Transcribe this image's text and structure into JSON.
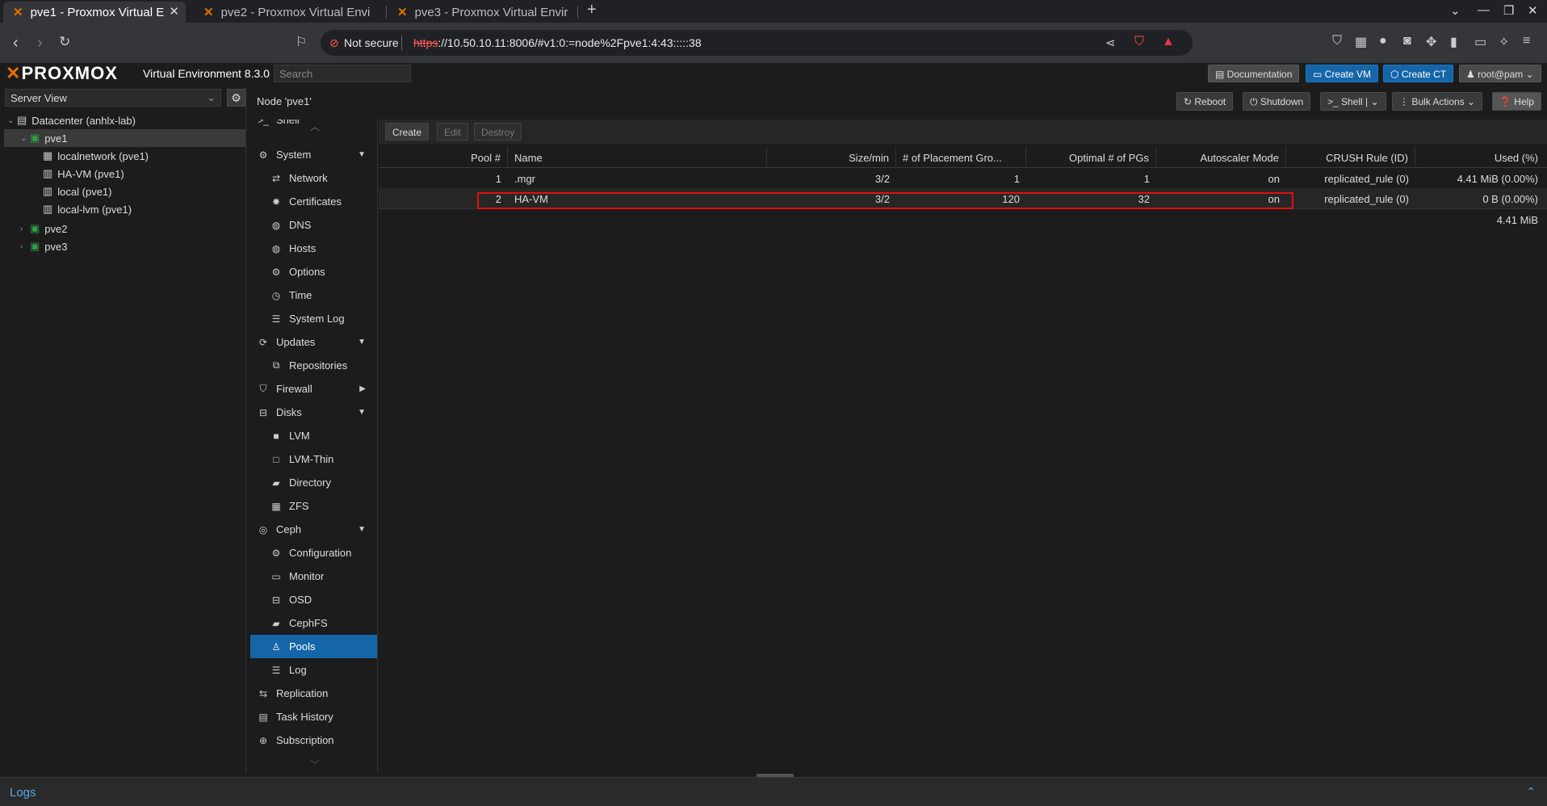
{
  "browser": {
    "tabs": [
      {
        "title": "pve1 - Proxmox Virtual E",
        "active": true
      },
      {
        "title": "pve2 - Proxmox Virtual Envi",
        "active": false
      },
      {
        "title": "pve3 - Proxmox Virtual Envir",
        "active": false
      }
    ],
    "not_secure": "Not secure",
    "url_scheme": "https",
    "url_rest": "://10.50.10.11:8006/#v1:0:=node%2Fpve1:4:43:::::38"
  },
  "header": {
    "logo": "PROXMOX",
    "version": "Virtual Environment 8.3.0",
    "search_placeholder": "Search",
    "documentation": "Documentation",
    "create_vm": "Create VM",
    "create_ct": "Create CT",
    "user": "root@pam"
  },
  "tree": {
    "view": "Server View",
    "items": [
      {
        "label": "Datacenter (anhlx-lab)"
      },
      {
        "label": "pve1"
      },
      {
        "label": "localnetwork (pve1)"
      },
      {
        "label": "HA-VM (pve1)"
      },
      {
        "label": "local (pve1)"
      },
      {
        "label": "local-lvm (pve1)"
      },
      {
        "label": "pve2"
      },
      {
        "label": "pve3"
      }
    ]
  },
  "node": {
    "title": "Node 'pve1'",
    "reboot": "Reboot",
    "shutdown": "Shutdown",
    "shell": "Shell",
    "bulk_actions": "Bulk Actions",
    "help": "Help"
  },
  "menu": {
    "shell": "Shell",
    "system": "System",
    "network": "Network",
    "certificates": "Certificates",
    "dns": "DNS",
    "hosts": "Hosts",
    "options": "Options",
    "time": "Time",
    "syslog": "System Log",
    "updates": "Updates",
    "repositories": "Repositories",
    "firewall": "Firewall",
    "disks": "Disks",
    "lvm": "LVM",
    "lvm_thin": "LVM-Thin",
    "directory": "Directory",
    "zfs": "ZFS",
    "ceph": "Ceph",
    "configuration": "Configuration",
    "monitor": "Monitor",
    "osd": "OSD",
    "cephfs": "CephFS",
    "pools": "Pools",
    "log": "Log",
    "replication": "Replication",
    "task_history": "Task History",
    "subscription": "Subscription"
  },
  "toolbar": {
    "create": "Create",
    "edit": "Edit",
    "destroy": "Destroy"
  },
  "pools": {
    "columns": [
      "Pool #",
      "Name",
      "Size/min",
      "# of Placement Gro...",
      "Optimal # of PGs",
      "Autoscaler Mode",
      "CRUSH Rule (ID)",
      "Used (%)"
    ],
    "rows": [
      {
        "id": "1",
        "name": ".mgr",
        "size": "3/2",
        "pgs": "1",
        "optimal": "1",
        "autoscale": "on",
        "crush": "replicated_rule (0)",
        "used": "4.41 MiB (0.00%)"
      },
      {
        "id": "2",
        "name": "HA-VM",
        "size": "3/2",
        "pgs": "120",
        "optimal": "32",
        "autoscale": "on",
        "crush": "replicated_rule (0)",
        "used": "0 B (0.00%)"
      }
    ],
    "total": "4.41 MiB"
  },
  "logs": {
    "label": "Logs"
  }
}
